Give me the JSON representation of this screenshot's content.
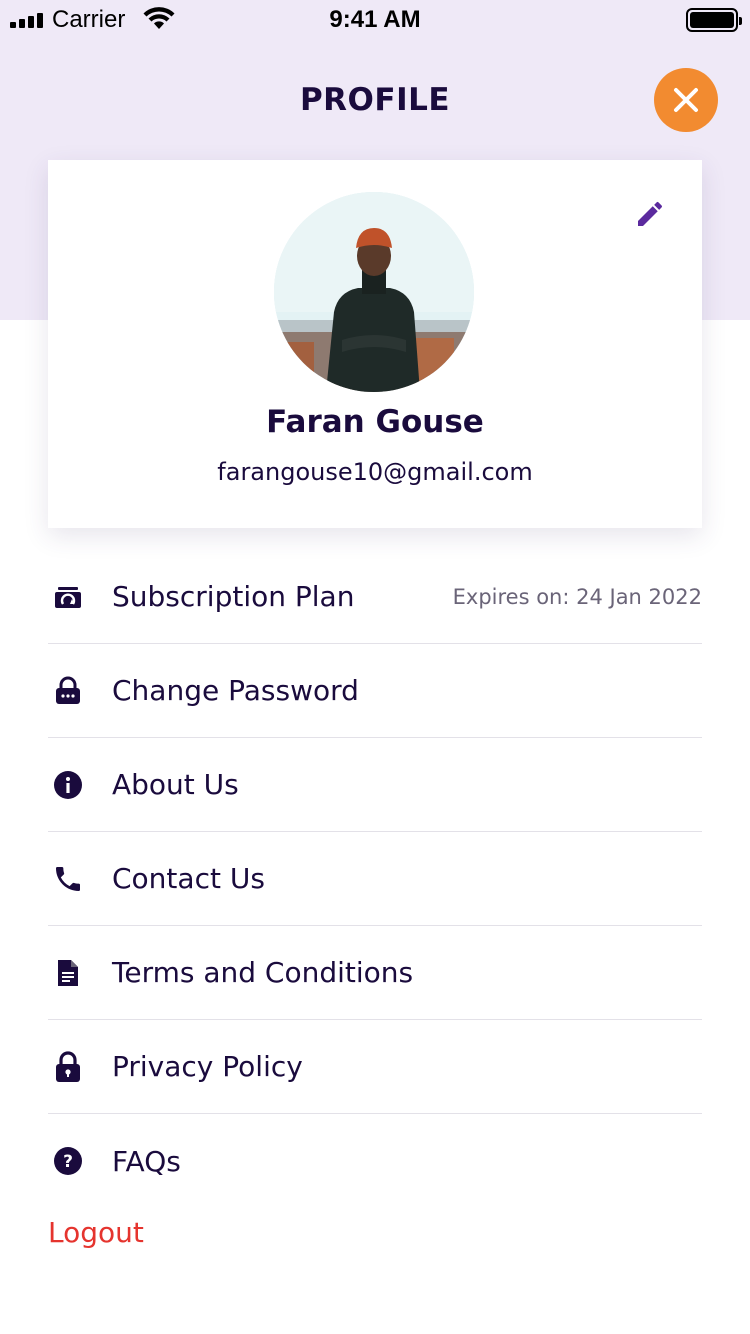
{
  "status_bar": {
    "carrier": "Carrier",
    "time": "9:41 AM"
  },
  "header": {
    "title": "PROFILE",
    "close_icon": "close-icon",
    "accent_color": "#f28b30"
  },
  "profile": {
    "name": "Faran Gouse",
    "email": "farangouse10@gmail.com",
    "edit_icon": "pencil-icon"
  },
  "menu": {
    "items": [
      {
        "label": "Subscription Plan",
        "icon": "wallet-icon",
        "meta": "Expires on: 24 Jan 2022"
      },
      {
        "label": "Change Password",
        "icon": "password-lock-icon"
      },
      {
        "label": "About Us",
        "icon": "info-icon"
      },
      {
        "label": "Contact Us",
        "icon": "phone-icon"
      },
      {
        "label": "Terms and Conditions",
        "icon": "document-icon"
      },
      {
        "label": "Privacy Policy",
        "icon": "lock-icon"
      },
      {
        "label": "FAQs",
        "icon": "help-icon"
      }
    ]
  },
  "logout_label": "Logout",
  "colors": {
    "header_bg": "#efe9f7",
    "text": "#1a0b3d",
    "logout": "#e5342e",
    "edit": "#5b2a9e"
  }
}
